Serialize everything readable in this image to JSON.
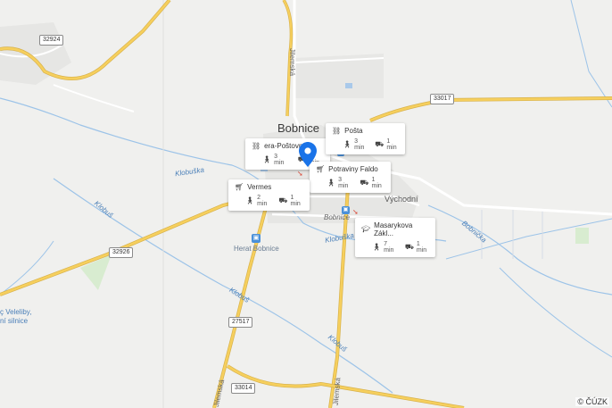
{
  "map": {
    "town_label": "Bobnice",
    "attribution": "© ČÚZK",
    "route_shields": [
      "32924",
      "33017",
      "32926",
      "27517",
      "33014"
    ],
    "water_labels": [
      "Klobuška",
      "Klobuš",
      "Klobuška",
      "Klobuš",
      "Klobuš",
      "Bobnička"
    ],
    "street_labels": [
      "Jilemská",
      "Východní",
      "Bobnice",
      "Jilemská",
      "Jilemská"
    ],
    "side_label": [
      "ç Veleliby,",
      "ní silnice"
    ],
    "poi_labels": [
      "Herat Bobnice"
    ]
  },
  "popups": [
    {
      "name": "era-Poštovní",
      "icon": "network-icon",
      "walk": "3 min",
      "drive": "1 min"
    },
    {
      "name": "Pošta",
      "icon": "network-icon",
      "walk": "3 min",
      "drive": "1 min"
    },
    {
      "name": "Potraviny Faldo",
      "icon": "cart-icon",
      "walk": "3 min",
      "drive": "1 min"
    },
    {
      "name": "Vermes",
      "icon": "cart-icon",
      "walk": "2 min",
      "drive": "1 min"
    },
    {
      "name": "Masarykova Zákl...",
      "icon": "school-icon",
      "walk": "7 min",
      "drive": "1 min"
    }
  ],
  "colors": {
    "background": "#f0f0ee",
    "major_road": "#f6cf5d",
    "minor_road": "#ffffff",
    "water": "#9cc3e8",
    "pin": "#1a73e8"
  }
}
